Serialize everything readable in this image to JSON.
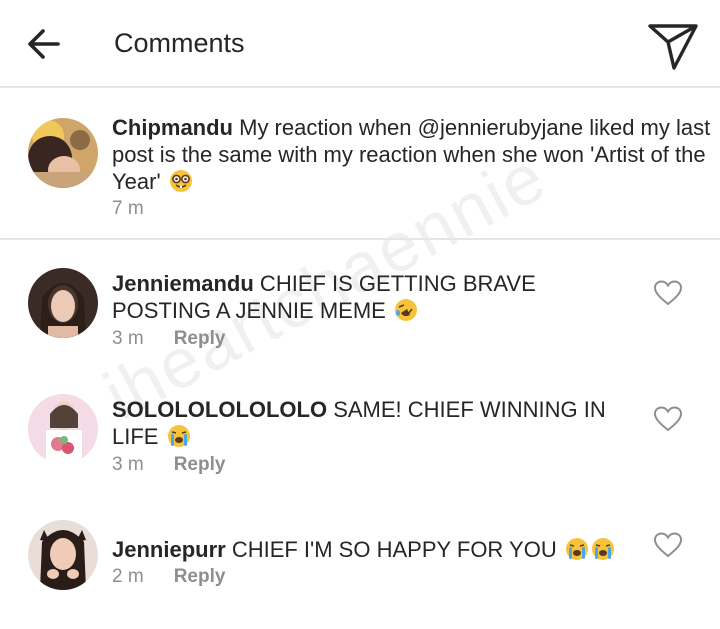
{
  "header": {
    "title": "Comments",
    "back_icon": "arrow-left-icon",
    "send_icon": "paper-plane-icon"
  },
  "caption": {
    "username": "Chipmandu",
    "text": " My reaction when @jennierubyjane liked my last post is the same with my reaction when she won 'Artist of the Year' ",
    "emoji": "nerd-face-emoji",
    "time": "7 m"
  },
  "comments": [
    {
      "username": "Jenniemandu",
      "text": " CHIEF IS GETTING BRAVE POSTING A JENNIE MEME ",
      "emojis": [
        "rolling-laughing-emoji"
      ],
      "time": "3 m",
      "reply": "Reply"
    },
    {
      "username": "SOLOLOLOLOLOLO",
      "text": " SAME! CHIEF WINNING IN LIFE ",
      "emojis": [
        "loudly-crying-emoji"
      ],
      "time": "3 m",
      "reply": "Reply"
    },
    {
      "username": "Jenniepurr",
      "text": " CHIEF I'M SO HAPPY FOR YOU ",
      "emojis": [
        "loudly-crying-emoji",
        "loudly-crying-emoji"
      ],
      "time": "2 m",
      "reply": "Reply"
    }
  ],
  "watermark": "iheartchaennie",
  "colors": {
    "text": "#262626",
    "muted": "#8e8e8e",
    "divider": "#e6e6e6",
    "emoji_yellow": "#f7c33a"
  }
}
